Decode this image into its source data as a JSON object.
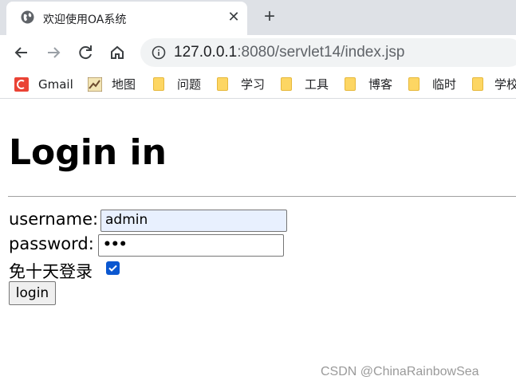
{
  "browser": {
    "tab": {
      "title": "欢迎使用OA系统",
      "close_glyph": "✕",
      "favicon": "globe-icon"
    },
    "new_tab_glyph": "+",
    "url": {
      "host": "127.0.0.1",
      "rest": ":8080/servlet14/index.jsp"
    },
    "bookmarks": [
      {
        "label": "Gmail",
        "icon": "gmail-icon"
      },
      {
        "label": "地图",
        "icon": "map-icon"
      },
      {
        "label": "问题",
        "icon": "folder-icon"
      },
      {
        "label": "学习",
        "icon": "folder-icon"
      },
      {
        "label": "工具",
        "icon": "folder-icon"
      },
      {
        "label": "博客",
        "icon": "folder-icon"
      },
      {
        "label": "临时",
        "icon": "folder-icon"
      },
      {
        "label": "学校",
        "icon": "folder-icon"
      }
    ]
  },
  "page": {
    "heading": "Login in",
    "username_label": "username:",
    "username_value": "admin",
    "password_label": "password:",
    "password_value": "•••",
    "remember_label": "免十天登录",
    "remember_checked": true,
    "login_button": "login"
  },
  "watermark": "CSDN @ChinaRainbowSea",
  "colors": {
    "accent": "#0b57d0",
    "autofill": "#e8f0fe",
    "tabbar": "#dee1e6"
  }
}
